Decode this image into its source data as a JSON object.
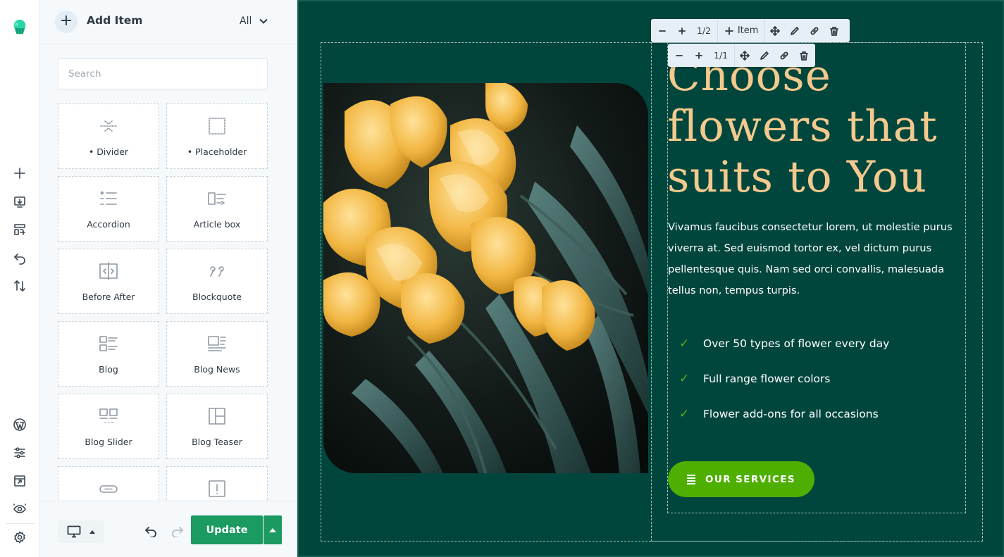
{
  "rail": {
    "items": [
      "logo",
      "add-icon",
      "import-icon",
      "layout-icon",
      "undo-history-icon",
      "sort-icon",
      "wordpress-icon",
      "settings-sliders-icon",
      "preview-screen-icon",
      "eye-icon",
      "gear-icon"
    ]
  },
  "panel": {
    "title": "Add Item",
    "filter": "All",
    "search_placeholder": "Search",
    "items": [
      {
        "label": "• Divider",
        "icon": "divider-icon"
      },
      {
        "label": "• Placeholder",
        "icon": "placeholder-icon"
      },
      {
        "label": "Accordion",
        "icon": "accordion-icon"
      },
      {
        "label": "Article box",
        "icon": "article-box-icon"
      },
      {
        "label": "Before After",
        "icon": "before-after-icon"
      },
      {
        "label": "Blockquote",
        "icon": "blockquote-icon"
      },
      {
        "label": "Blog",
        "icon": "blog-icon"
      },
      {
        "label": "Blog News",
        "icon": "blog-news-icon"
      },
      {
        "label": "Blog Slider",
        "icon": "blog-slider-icon"
      },
      {
        "label": "Blog Teaser",
        "icon": "blog-teaser-icon"
      },
      {
        "label": "",
        "icon": "button-icon"
      },
      {
        "label": "",
        "icon": "alert-icon"
      }
    ],
    "footer": {
      "update_label": "Update"
    }
  },
  "toolbar_outer": {
    "count": "1/2",
    "item_label": "Item"
  },
  "toolbar_inner": {
    "count": "1/1"
  },
  "content": {
    "heading": "Choose flowers that suits to You",
    "body": "Vivamus faucibus consectetur lorem, ut molestie purus viverra at. Sed euismod tortor ex, vel dictum purus pellentesque quis. Nam sed orci convallis, malesuada tellus non, tempus turpis.",
    "features": [
      "Over 50 types of flower every day",
      "Full range flower colors",
      "Flower add-ons for all occasions"
    ],
    "check_glyph": "✓",
    "cta": "OUR SERVICES"
  },
  "colors": {
    "canvas_bg": "#01463d",
    "heading": "#f3c98e",
    "accent_green": "#4eaf00",
    "update_button": "#1b9a62",
    "check": "#4bb619"
  }
}
